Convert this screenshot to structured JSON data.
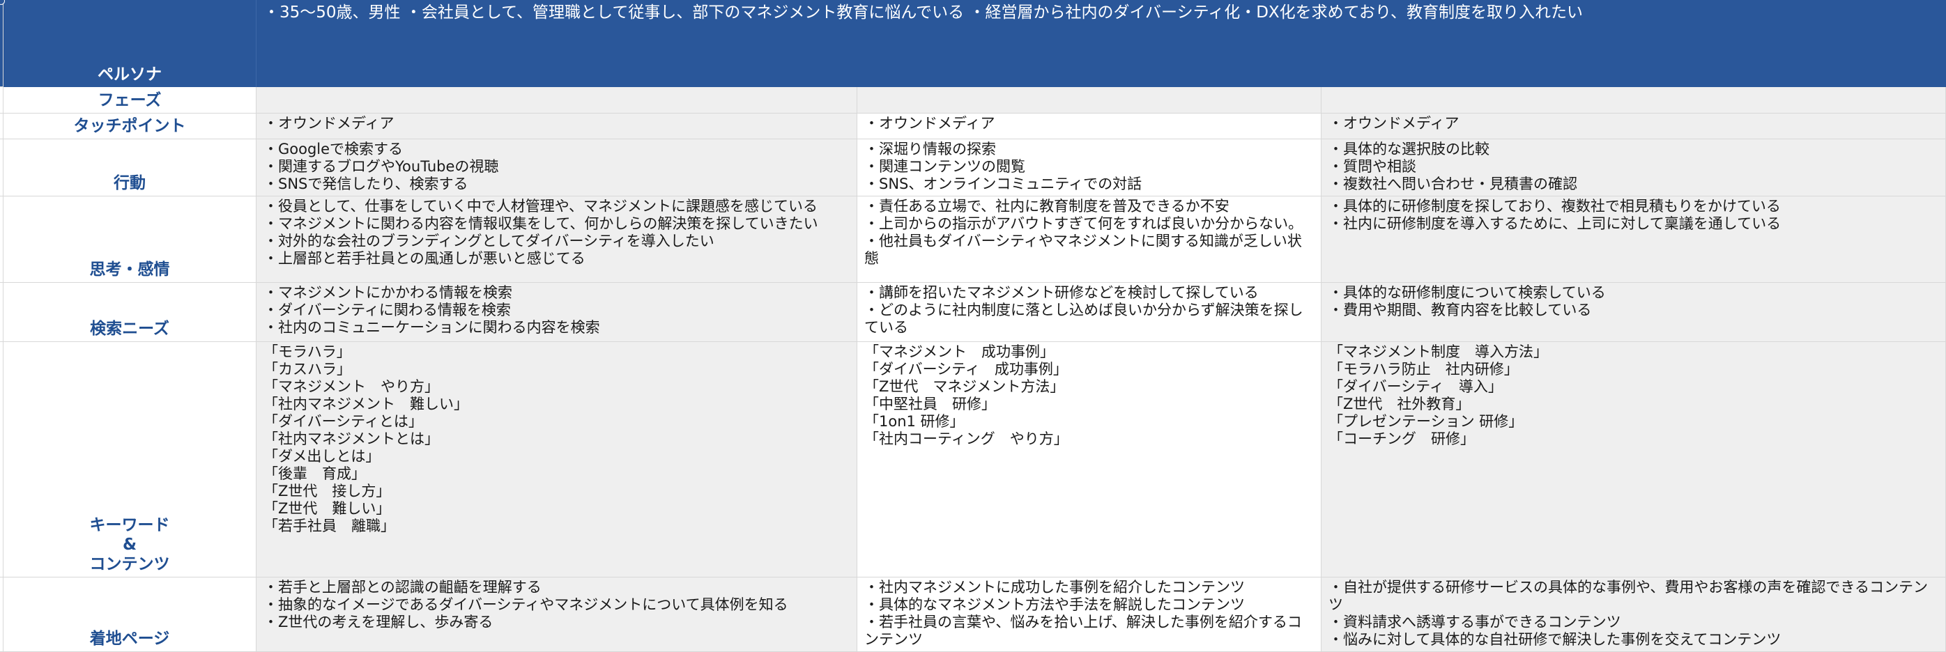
{
  "persona": {
    "label": "ペルソナ",
    "lines": [
      "・35〜50歳、男性",
      "・会社員として、管理職として従事し、部下のマネジメント教育に悩んでいる",
      "・経営層から社内のダイバーシティ化・DX化を求めており、教育制度を取り入れたい"
    ]
  },
  "rows": [
    {
      "label": "フェーズ",
      "cells": [
        [],
        [],
        []
      ]
    },
    {
      "label": "タッチポイント",
      "cells": [
        [
          "・オウンドメディア"
        ],
        [
          "・オウンドメディア"
        ],
        [
          "・オウンドメディア"
        ]
      ]
    },
    {
      "label": "行動",
      "cells": [
        [
          "・Googleで検索する",
          "・関連するブログやYouTubeの視聴",
          "・SNSで発信したり、検索する"
        ],
        [
          "・深堀り情報の探索",
          "・関連コンテンツの閲覧",
          "・SNS、オンラインコミュニティでの対話"
        ],
        [
          "・具体的な選択肢の比較",
          "・質問や相談",
          "・複数社へ問い合わせ・見積書の確認"
        ]
      ]
    },
    {
      "label": "思考・感情",
      "cells": [
        [
          "・役員として、仕事をしていく中で人材管理や、マネジメントに課題感を感じている",
          "・マネジメントに関わる内容を情報収集をして、何かしらの解決策を探していきたい",
          "・対外的な会社のブランディングとしてダイバーシティを導入したい",
          "・上層部と若手社員との風通しが悪いと感じてる"
        ],
        [
          "・責任ある立場で、社内に教育制度を普及できるか不安",
          "・上司からの指示がアバウトすぎて何をすれば良いか分からない。",
          "・他社員もダイバーシティやマネジメントに関する知識が乏しい状態"
        ],
        [
          "・具体的に研修制度を探しており、複数社で相見積もりをかけている",
          "・社内に研修制度を導入するために、上司に対して稟議を通している"
        ]
      ]
    },
    {
      "label": "検索ニーズ",
      "cells": [
        [
          "・マネジメントにかかわる情報を検索",
          "・ダイバーシティに関わる情報を検索",
          "・社内のコミュニーケーションに関わる内容を検索"
        ],
        [
          "・講師を招いたマネジメント研修などを検討して探している",
          "・どのように社内制度に落とし込めば良いか分からず解決策を探している"
        ],
        [
          "・具体的な研修制度について検索している",
          "・費用や期間、教育内容を比較している"
        ]
      ]
    },
    {
      "label": [
        "キーワード",
        "&",
        "コンテンツ"
      ],
      "cells": [
        [
          "「モラハラ」",
          "「カスハラ」",
          "「マネジメント　やり方」",
          "「社内マネジメント　難しい」",
          "「ダイバーシティとは」",
          "「社内マネジメントとは」",
          "「ダメ出しとは」",
          "「後輩　育成」",
          "「Z世代　接し方」",
          "「Z世代　難しい」",
          "「若手社員　離職」"
        ],
        [
          "「マネジメント　成功事例」",
          "「ダイバーシティ　成功事例」",
          "「Z世代　マネジメント方法」",
          "「中堅社員　研修」",
          "「1on1 研修」",
          "「社内コーティング　やり方」"
        ],
        [
          "「マネジメント制度　導入方法」",
          "「モラハラ防止　社内研修」",
          "「ダイバーシティ　導入」",
          "「Z世代　社外教育」",
          "「プレゼンテーション 研修」",
          "「コーチング　研修」"
        ]
      ]
    },
    {
      "label": "着地ページ",
      "cells": [
        [
          "・若手と上層部との認識の齟齬を理解する",
          "・抽象的なイメージであるダイバーシティやマネジメントについて具体例を知る",
          "・Z世代の考えを理解し、歩み寄る"
        ],
        [
          "・社内マネジメントに成功した事例を紹介したコンテンツ",
          "・具体的なマネジメント方法や手法を解説したコンテンツ",
          "・若手社員の言葉や、悩みを拾い上げ、解決した事例を紹介するコンテンツ"
        ],
        [
          "・自社が提供する研修サービスの具体的な事例や、費用やお客様の声を確認できるコンテンツ",
          "・資料請求へ誘導する事ができるコンテンツ",
          "・悩みに対して具体的な自社研修で解決した事例を交えてコンテンツ"
        ]
      ]
    }
  ],
  "colors": {
    "header_bg": "#2a579a",
    "label_text": "#1f4e91",
    "cell_grey": "#efefef"
  }
}
